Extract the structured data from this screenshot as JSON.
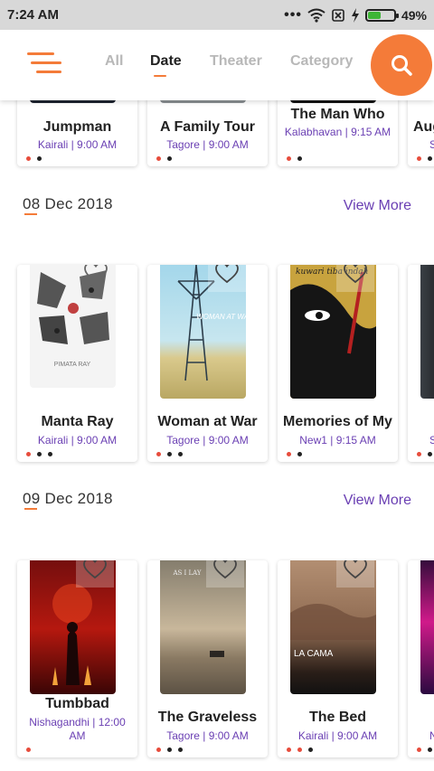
{
  "status_bar": {
    "time": "7:24 AM",
    "battery_pct": "49%",
    "battery_level": 0.49
  },
  "app_bar": {
    "tabs": [
      {
        "label": "All",
        "active": false
      },
      {
        "label": "Date",
        "active": true
      },
      {
        "label": "Theater",
        "active": false
      },
      {
        "label": "Category",
        "active": false
      }
    ]
  },
  "colors": {
    "accent": "#f47b39",
    "link": "#6a3fb3",
    "dot_active": "#e74c3c"
  },
  "top_row": [
    {
      "title": "Jumpman",
      "subtitle": "Kairali | 9:00 AM"
    },
    {
      "title": "A Family Tour",
      "subtitle": "Tagore | 9:00 AM"
    },
    {
      "title": "The Man Who",
      "subtitle": "Kalabhavan | 9:15 AM"
    },
    {
      "title": "Aug",
      "subtitle": "S"
    }
  ],
  "sections": [
    {
      "date": "08 Dec 2018",
      "view_more": "View More",
      "cards": [
        {
          "title": "Manta Ray",
          "subtitle": "Kairali | 9:00 AM",
          "poster_text": "PIMATA RAY"
        },
        {
          "title": "Woman at War",
          "subtitle": "Tagore | 9:00 AM",
          "poster_text": "WOMAN AT WAR"
        },
        {
          "title": "Memories of My",
          "subtitle": "New1 | 9:15 AM",
          "poster_text": "kuwari tiba indah"
        },
        {
          "title": "",
          "subtitle": "S"
        }
      ]
    },
    {
      "date": "09 Dec 2018",
      "view_more": "View More",
      "cards": [
        {
          "title": "Tumbbad",
          "subtitle": "Nishagandhi | 12:00 AM"
        },
        {
          "title": "The Graveless",
          "subtitle": "Tagore | 9:00 AM",
          "poster_text": "AS I LAY"
        },
        {
          "title": "The Bed",
          "subtitle": "Kairali | 9:00 AM",
          "poster_text": "LA CAMA"
        },
        {
          "title": "",
          "subtitle": "N"
        }
      ]
    }
  ]
}
